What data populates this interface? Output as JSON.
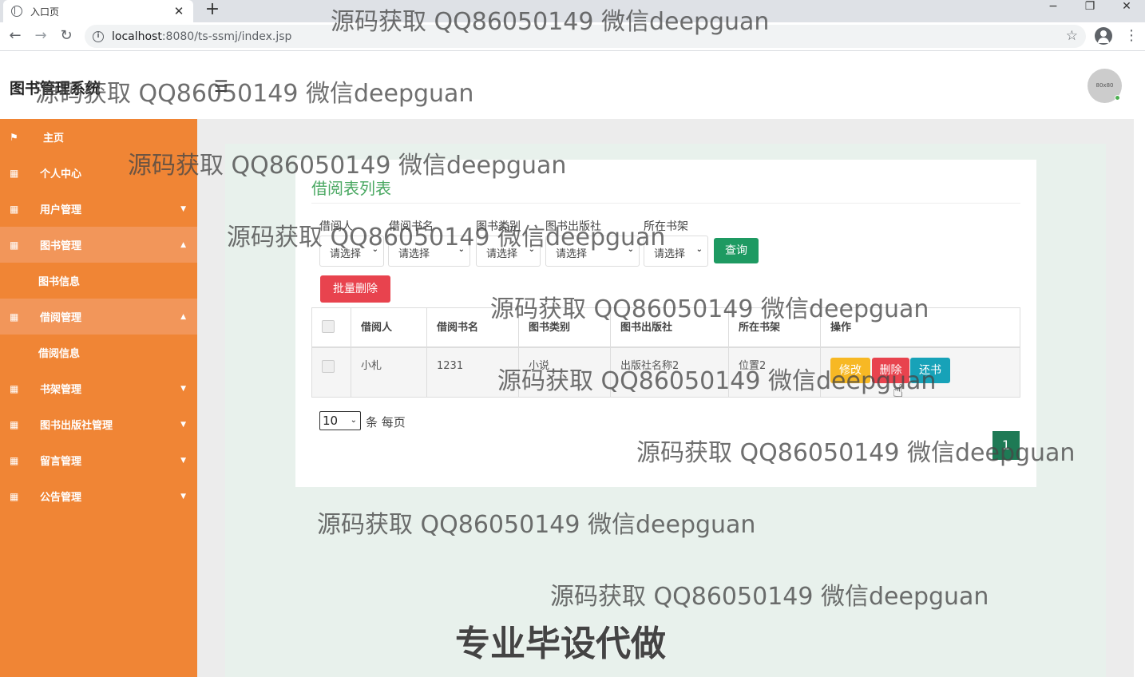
{
  "browser": {
    "tab_title": "入口页",
    "new_tab": "+",
    "url_host": "localhost",
    "url_rest": ":8080/ts-ssmj/index.jsp",
    "controls": {
      "minimize": "−",
      "restore": "❐",
      "close": "✕"
    }
  },
  "header": {
    "brand": "图书管理系统",
    "avatar_text": "80x80"
  },
  "sidebar": {
    "items": [
      {
        "label": "主页",
        "icon": "flag-icon"
      },
      {
        "label": "个人中心",
        "icon": "grid-icon"
      },
      {
        "label": "用户管理",
        "icon": "grid-icon"
      },
      {
        "label": "图书管理",
        "icon": "grid-icon"
      },
      {
        "label": "图书信息"
      },
      {
        "label": "借阅管理",
        "icon": "grid-icon"
      },
      {
        "label": "借阅信息"
      },
      {
        "label": "书架管理",
        "icon": "grid-icon"
      },
      {
        "label": "图书出版社管理",
        "icon": "grid-icon"
      },
      {
        "label": "留言管理",
        "icon": "grid-icon"
      },
      {
        "label": "公告管理",
        "icon": "grid-icon"
      }
    ]
  },
  "main": {
    "card_title": "借阅表列表",
    "filters": [
      {
        "label": "借阅人",
        "value": "请选择"
      },
      {
        "label": "借阅书名",
        "value": "请选择"
      },
      {
        "label": "图书类别",
        "value": "请选择"
      },
      {
        "label": "图书出版社",
        "value": "请选择"
      },
      {
        "label": "所在书架",
        "value": "请选择"
      }
    ],
    "query_button": "查询",
    "batch_delete_button": "批量删除",
    "table": {
      "columns": [
        "借阅人",
        "借阅书名",
        "图书类别",
        "图书出版社",
        "所在书架",
        "操作"
      ],
      "rows": [
        {
          "borrower": "小札",
          "book_name": "1231",
          "category": "小说",
          "publisher": "出版社名称2",
          "shelf": "位置2"
        }
      ],
      "actions": {
        "edit": "修改",
        "delete": "删除",
        "return": "还书"
      }
    },
    "page_size": "10",
    "page_size_label": "条 每页",
    "current_page": "1"
  },
  "colors": {
    "sidebar": "#f08535",
    "title_green": "#4aa862",
    "query_green": "#1e9a62",
    "batch_red": "#e8434e",
    "edit_yellow": "#f7b824",
    "delete_red": "#e8434e",
    "return_teal": "#17a2b8"
  },
  "watermarks": {
    "text": "源码获取 QQ86050149 微信deepguan",
    "banner": "专业毕设代做"
  }
}
